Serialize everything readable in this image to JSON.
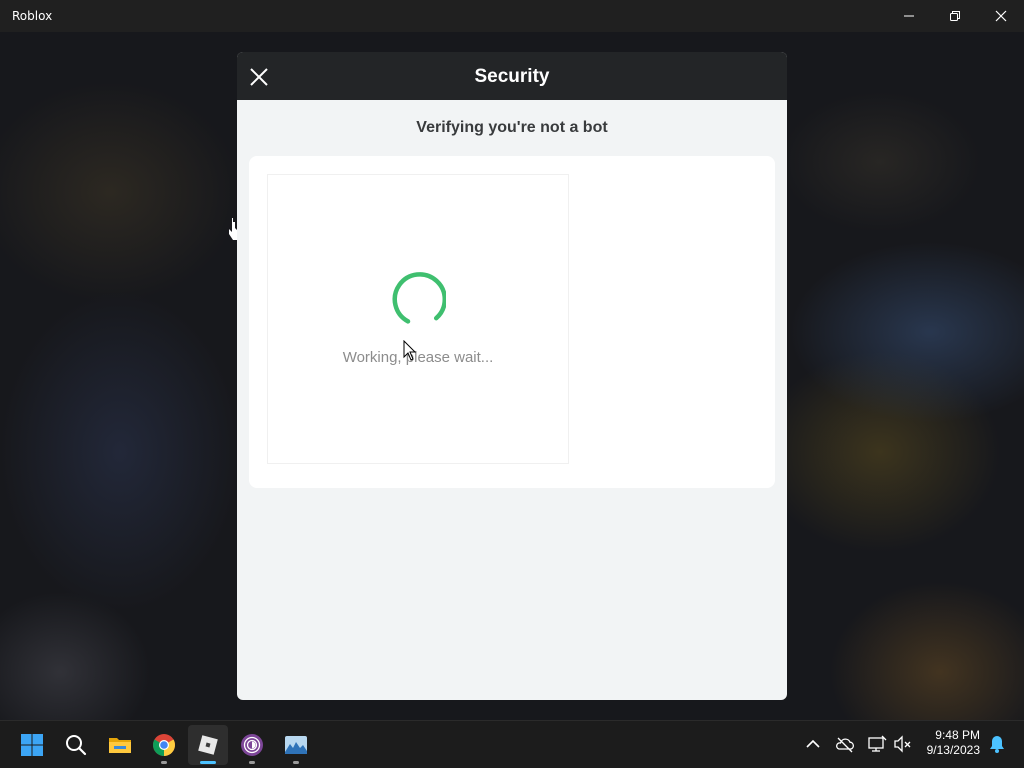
{
  "window": {
    "title": "Roblox"
  },
  "dialog": {
    "title": "Security",
    "subtitle": "Verifying you're not a bot",
    "status_text": "Working, please wait...",
    "spinner_color": "#3fbf6f"
  },
  "taskbar": {
    "apps": [
      {
        "name": "start",
        "icon": "windows-logo-icon"
      },
      {
        "name": "search",
        "icon": "search-icon"
      },
      {
        "name": "file-explorer",
        "icon": "folder-icon"
      },
      {
        "name": "chrome",
        "icon": "chrome-icon"
      },
      {
        "name": "roblox",
        "icon": "roblox-icon",
        "active": true
      },
      {
        "name": "tor-browser",
        "icon": "tor-icon"
      },
      {
        "name": "photos",
        "icon": "photos-icon"
      }
    ],
    "tray": [
      "chevron-up-icon",
      "onedrive-icon",
      "network-icon",
      "volume-muted-icon",
      "notification-bell-icon"
    ],
    "time": "9:48 PM",
    "date": "9/13/2023"
  },
  "colors": {
    "titlebar": "#202020",
    "modal_header": "#232527",
    "modal_body": "#f2f4f5",
    "taskbar": "#1c1c1c",
    "accent": "#4cc2ff"
  }
}
